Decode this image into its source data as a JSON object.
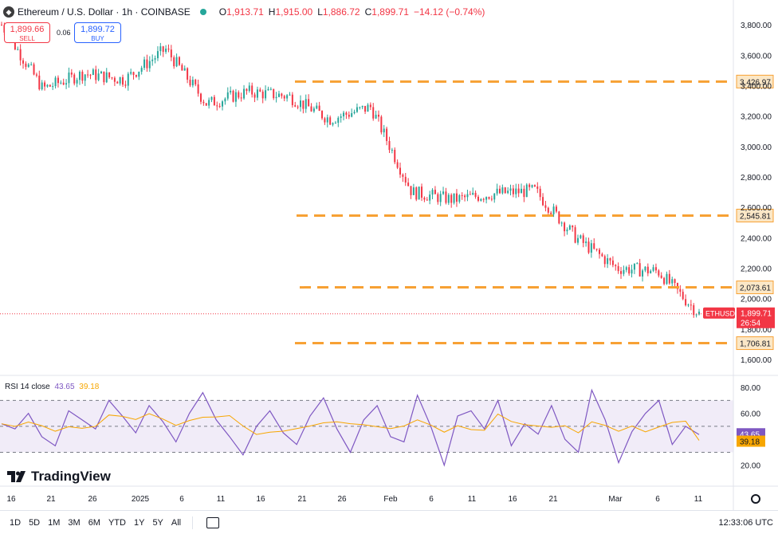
{
  "header": {
    "symbol_icon": "ethereum-icon",
    "title": "Ethereum / U.S. Dollar · 1h · COINBASE",
    "market_status": "open",
    "ohlc": {
      "o_label": "O",
      "o": "1,913.71",
      "h_label": "H",
      "h": "1,915.00",
      "l_label": "L",
      "l": "1,886.72",
      "c_label": "C",
      "c": "1,899.71",
      "change": "−14.12 (−0.74%)"
    }
  },
  "trade": {
    "sell_price": "1,899.66",
    "sell_label": "SELL",
    "buy_price": "1,899.72",
    "buy_label": "BUY",
    "spread": "0.06"
  },
  "price_axis": {
    "ticks": [
      "3,800.00",
      "3,600.00",
      "3,400.00",
      "3,200.00",
      "3,000.00",
      "2,800.00",
      "2,600.00",
      "2,400.00",
      "2,200.00",
      "2,000.00",
      "1,800.00",
      "1,600.00"
    ],
    "tick_values": [
      3800,
      3600,
      3400,
      3200,
      3000,
      2800,
      2600,
      2400,
      2200,
      2000,
      1800,
      1600
    ]
  },
  "levels": [
    {
      "label": "3,426.97",
      "value": 3426.97
    },
    {
      "label": "2,545.81",
      "value": 2545.81
    },
    {
      "label": "2,073.61",
      "value": 2073.61
    },
    {
      "label": "1,706.81",
      "value": 1706.81
    }
  ],
  "last_price": {
    "symbol": "ETHUSD",
    "price": "1,899.71",
    "countdown": "26:54",
    "value": 1899.71
  },
  "rsi": {
    "label": "RSI 14 close",
    "value": "43.65",
    "ma_value": "39.18",
    "ticks": [
      "80.00",
      "60.00",
      "40.00",
      "20.00"
    ],
    "tick_values": [
      80,
      60,
      40,
      20
    ],
    "band_upper": 70,
    "band_lower": 30,
    "mid": 50
  },
  "time_axis": [
    "16",
    "21",
    "26",
    "2025",
    "6",
    "11",
    "16",
    "21",
    "26",
    "Feb",
    "6",
    "11",
    "16",
    "21",
    "Mar",
    "6",
    "11"
  ],
  "bottom_bar": {
    "timeframes": [
      "1D",
      "5D",
      "1M",
      "3M",
      "6M",
      "YTD",
      "1Y",
      "5Y",
      "All"
    ],
    "clock": "12:33:06 UTC",
    "calendar_icon": "calendar-icon",
    "settings_icon": "gear-icon"
  },
  "logo_text": "TradingView",
  "colors": {
    "up": "#26a69a",
    "down": "#f23645",
    "level": "#f7a134",
    "rsi": "#7e57c2",
    "rsi_ma": "#f7a600",
    "rsi_band": "#ede7f6"
  },
  "chart_data": {
    "type": "candlestick",
    "title": "Ethereum / U.S. Dollar · 1h · COINBASE",
    "x": [
      "Dec 16",
      "Dec 21",
      "Dec 26",
      "Jan 1 2025",
      "Jan 6",
      "Jan 11",
      "Jan 16",
      "Jan 21",
      "Jan 26",
      "Feb 1",
      "Feb 6",
      "Feb 11",
      "Feb 16",
      "Feb 21",
      "Feb 26",
      "Mar 1",
      "Mar 6",
      "Mar 11"
    ],
    "close_approx": [
      3800,
      3380,
      3480,
      3440,
      3640,
      3280,
      3360,
      3330,
      3180,
      3260,
      2700,
      2650,
      2690,
      2710,
      2400,
      2200,
      2180,
      1899.71
    ],
    "ylim": [
      1500,
      3890
    ],
    "horizontal_levels": [
      3426.97,
      2545.81,
      2073.61,
      1706.81
    ],
    "rsi": {
      "period": 14,
      "last": 43.65,
      "ma_last": 39.18,
      "ylim": [
        10,
        85
      ],
      "values_approx": [
        52,
        48,
        60,
        42,
        35,
        62,
        55,
        48,
        70,
        58,
        45,
        66,
        54,
        38,
        60,
        76,
        55,
        42,
        28,
        50,
        62,
        45,
        36,
        58,
        72,
        48,
        30,
        55,
        66,
        42,
        38,
        74,
        50,
        20,
        58,
        62,
        48,
        70,
        35,
        52,
        44,
        66,
        40,
        30,
        78,
        55,
        22,
        46,
        60,
        70,
        36,
        50,
        43.65
      ]
    }
  }
}
